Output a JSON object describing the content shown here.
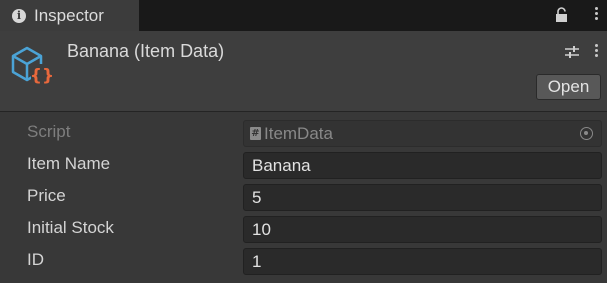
{
  "tab": {
    "title": "Inspector",
    "icon": "info-icon"
  },
  "tab_actions": {
    "lock_icon": "lock-icon",
    "menu_icon": "kebab-menu-icon"
  },
  "header": {
    "title": "Banana (Item Data)",
    "asset_icon": "scriptable-object-icon",
    "settings_icon": "sliders-icon",
    "menu_icon": "kebab-menu-icon",
    "open_label": "Open"
  },
  "fields": {
    "script": {
      "label": "Script",
      "value": "ItemData",
      "icon": "script-icon",
      "picker_icon": "object-picker-icon"
    },
    "item_name": {
      "label": "Item Name",
      "value": "Banana"
    },
    "price": {
      "label": "Price",
      "value": "5"
    },
    "initial_stock": {
      "label": "Initial Stock",
      "value": "10"
    },
    "id": {
      "label": "ID",
      "value": "1"
    }
  },
  "colors": {
    "background": "#383838",
    "tabbar": "#191919",
    "field_bg": "#2a2a2a",
    "asset_icon_cube": "#4ba3d6",
    "asset_icon_braces": "#e8683c"
  }
}
